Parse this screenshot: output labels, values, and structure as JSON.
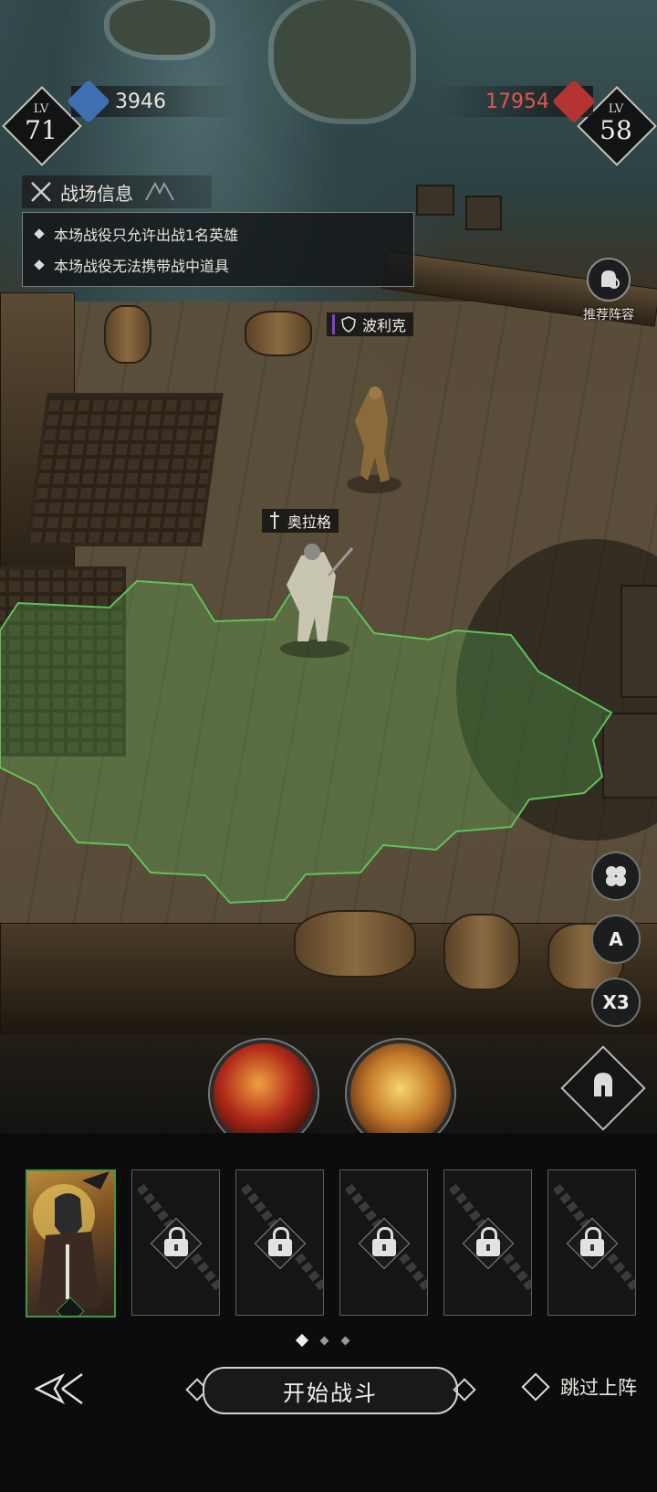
{
  "player": {
    "lv_label": "LV",
    "level": "71",
    "power": "3946"
  },
  "enemy": {
    "lv_label": "LV",
    "level": "58",
    "power": "17954"
  },
  "battlefield_info": {
    "title": "战场信息",
    "rules": [
      "本场战役只允许出战1名英雄",
      "本场战役无法携带战中道具"
    ]
  },
  "recommend": {
    "label": "推荐阵容"
  },
  "units": {
    "enemy_name": "波利克",
    "hero_name": "奥拉格"
  },
  "side_buttons": {
    "speed": "X3",
    "auto": "A"
  },
  "slots": {
    "unlocked": 1,
    "locked": 5
  },
  "pager": {
    "pages": 3,
    "active": 1
  },
  "actions": {
    "start_battle": "开始战斗",
    "skip_deploy": "跳过上阵"
  },
  "colors": {
    "player_accent": "#3f6fb0",
    "enemy_accent": "#b43434",
    "enemy_power_text": "#e0574f",
    "zone_outline": "#5ec25a",
    "hero_card_border": "#3f9a43"
  }
}
